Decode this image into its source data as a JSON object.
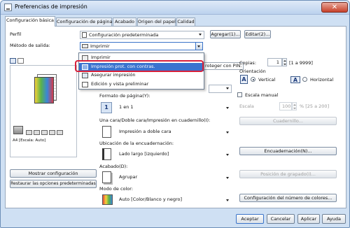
{
  "window": {
    "title": "Preferencias de impresión",
    "close_glyph": "✕"
  },
  "tabs": [
    "Configuración básica",
    "Configuración de página",
    "Acabado",
    "Origen del papel",
    "Calidad"
  ],
  "profile": {
    "label": "Perfil",
    "value": "Configuración predeterminada",
    "add_button": "Agregar(1)...",
    "edit_button": "Editar(2)..."
  },
  "output_method": {
    "label": "Método de salida:",
    "value": "Imprimir",
    "options": [
      "Imprimir",
      "Impresión prot. con contras.",
      "Asegurar impresión",
      "Edición y vista preliminar"
    ],
    "selected_index": 1,
    "hidden_suffix": "roteger con PIN."
  },
  "copies": {
    "label": "Copias:",
    "value": "1",
    "range": "[1 a 9999]"
  },
  "orientation": {
    "label": "Orientación",
    "portrait": "Vertical",
    "landscape": "Horizontal",
    "selected": "Vertical"
  },
  "page_layout": {
    "label": "Formato de página(Y):",
    "value": "1 en 1"
  },
  "manual_scale": {
    "label": "Escala manual",
    "scale_label": "Escala",
    "scale_value": "100",
    "scale_range": "% [25 a 200]"
  },
  "duplex": {
    "label": "Una cara/Doble cara/Impresión en cuadernillo(I):",
    "value": "Impresión a doble cara"
  },
  "watermark_button": "Cuadernillo...",
  "binding": {
    "label": "Ubicación de la encuadernación:",
    "value": "Lado largo [izquierdo]"
  },
  "binding_button": "Encuadernación(N)...",
  "finishing": {
    "label": "Acabado(D):",
    "value": "Agrupar"
  },
  "staple_button": "Posición de grapado(I)...",
  "color_mode": {
    "label": "Modo de color:",
    "value": "Auto [Color/Blanco y negro]"
  },
  "color_button": "Configuración del número de colores...",
  "preview": {
    "caption": "A4 [Escala: Auto]"
  },
  "show_settings_button": "Mostrar configuración",
  "restore_button": "Restaurar las opciones predeterminadas",
  "footer": {
    "ok": "Aceptar",
    "cancel": "Cancelar",
    "apply": "Aplicar",
    "help": "Ayuda"
  },
  "colors": {
    "accent": "#3a73cf",
    "highlight": "#d8203a",
    "titlebar": "#bcd2ee"
  }
}
